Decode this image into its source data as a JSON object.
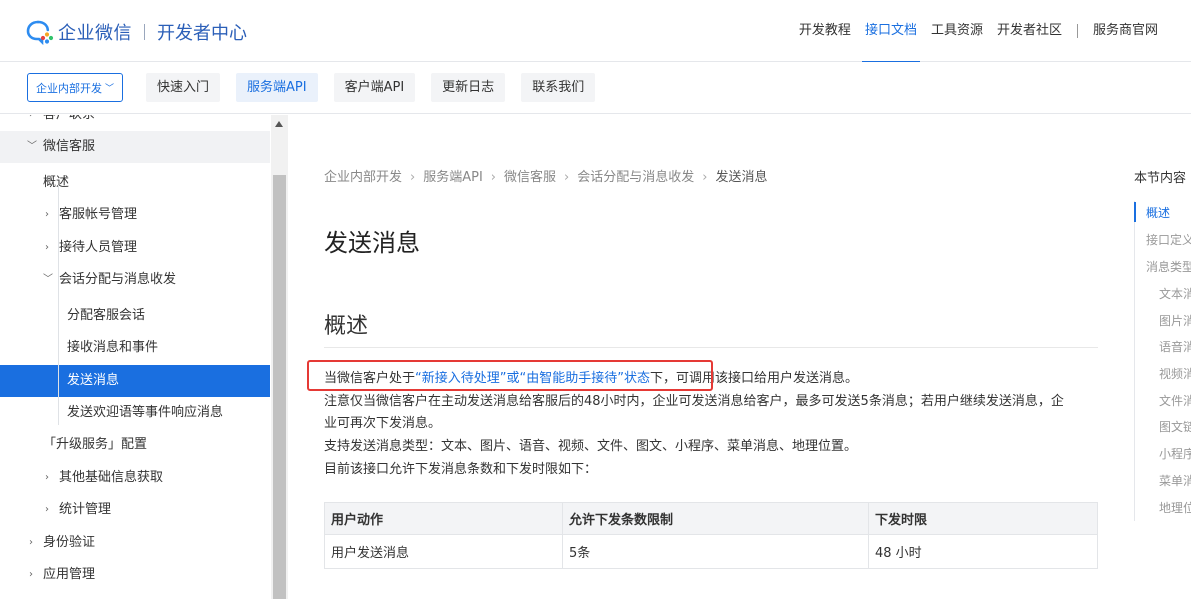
{
  "header": {
    "brand": "企业微信",
    "subtitle": "开发者中心",
    "nav": [
      {
        "label": "开发教程",
        "active": false
      },
      {
        "label": "接口文档",
        "active": true
      },
      {
        "label": "工具资源",
        "active": false
      },
      {
        "label": "开发者社区",
        "active": false
      },
      {
        "label": "服务商官网",
        "active": false
      }
    ]
  },
  "subbar": {
    "dropdown": "企业内部开发",
    "tabs": [
      "快速入门",
      "服务端API",
      "客户端API",
      "更新日志",
      "联系我们"
    ],
    "active_tab": "服务端API"
  },
  "sidebar": {
    "items": [
      {
        "label": "客户联系"
      },
      {
        "label": "微信客服"
      },
      {
        "label": "概述"
      },
      {
        "label": "客服帐号管理"
      },
      {
        "label": "接待人员管理"
      },
      {
        "label": "会话分配与消息收发"
      },
      {
        "label": "分配客服会话"
      },
      {
        "label": "接收消息和事件"
      },
      {
        "label": "发送消息"
      },
      {
        "label": "发送欢迎语等事件响应消息"
      },
      {
        "label": "「升级服务」配置"
      },
      {
        "label": "其他基础信息获取"
      },
      {
        "label": "统计管理"
      },
      {
        "label": "身份验证"
      },
      {
        "label": "应用管理"
      }
    ]
  },
  "breadcrumb": [
    "企业内部开发",
    "服务端API",
    "微信客服",
    "会话分配与消息收发",
    "发送消息"
  ],
  "page": {
    "title": "发送消息",
    "section": "概述",
    "p1_prefix": "当微信客户处于",
    "p1_link": "“新接入待处理”或“由智能助手接待”状态",
    "p1_mid": "下",
    "p1_suffix": "，可调用该接口给用户发送消息。",
    "p2_line1": "注意仅当微信客户在主动发送消息给客服后的48小时内，企业可发送消息给客户，最多可发送5条消息；若用户继续发送消息，企",
    "p2_line2": "业可再次下发消息。",
    "p3": "支持发送消息类型：文本、图片、语音、视频、文件、图文、小程序、菜单消息、地理位置。",
    "p4": "目前该接口允许下发消息条数和下发时限如下："
  },
  "table": {
    "headers": [
      "用户动作",
      "允许下发条数限制",
      "下发时限"
    ],
    "rows": [
      [
        "用户发送消息",
        "5条",
        "48 小时"
      ]
    ]
  },
  "toc": {
    "title": "本节内容",
    "items": [
      "概述",
      "接口定义",
      "消息类型",
      "文本消息",
      "图片消息",
      "语音消息",
      "视频消息",
      "文件消息",
      "图文链接",
      "小程序消息",
      "菜单消息",
      "地理位置"
    ]
  },
  "colors": {
    "accent": "#1a6fe0",
    "highlight": "#e53935"
  }
}
